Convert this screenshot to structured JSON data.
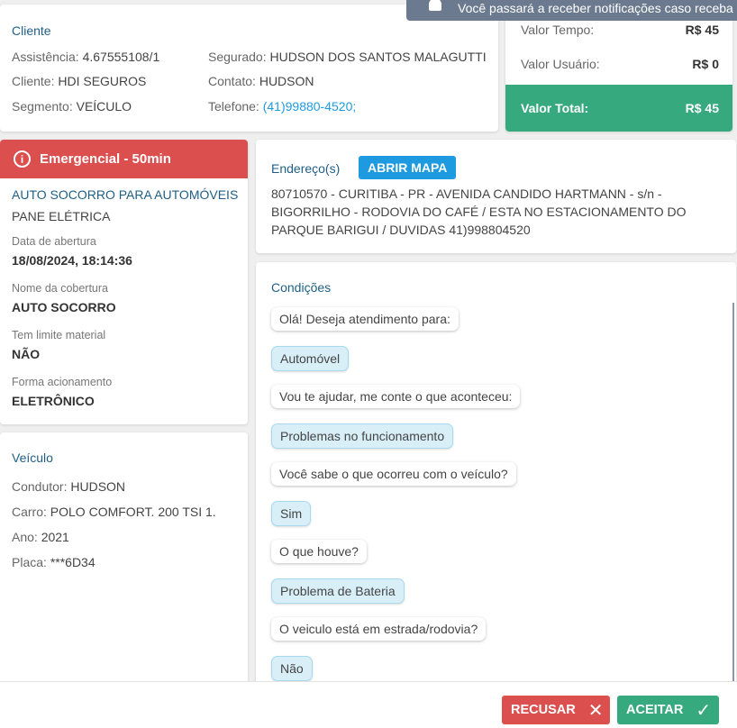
{
  "toast": {
    "text": "Você passará a receber notificações caso receba algum",
    "icon": "bell-icon"
  },
  "cliente": {
    "title": "Cliente",
    "assistencia_label": "Assistência:",
    "assistencia": "4.67555108/1",
    "cliente_label": "Cliente:",
    "cliente": "HDI SEGUROS",
    "segmento_label": "Segmento:",
    "segmento": "VEÍCULO",
    "segurado_label": "Segurado:",
    "segurado": "HUDSON DOS SANTOS MALAGUTTI",
    "contato_label": "Contato:",
    "contato": "HUDSON",
    "telefone_label": "Telefone:",
    "telefone": "(41)99880-4520;"
  },
  "valores": {
    "tempo_label": "Valor Tempo:",
    "tempo": "R$ 45",
    "usuario_label": "Valor Usuário:",
    "usuario": "R$ 0",
    "total_label": "Valor Total:",
    "total": "R$ 45",
    "total_color": "#36a97f"
  },
  "servico": {
    "badge": "Emergencial - 50min",
    "badge_color": "#dc4f4f",
    "title": "AUTO SOCORRO PARA AUTOMÓVEIS",
    "subtitle": "PANE ELÉTRICA",
    "fields": [
      {
        "label": "Data de abertura",
        "value": "18/08/2024, 18:14:36"
      },
      {
        "label": "Nome da cobertura",
        "value": "AUTO SOCORRO"
      },
      {
        "label": "Tem limite material",
        "value": "NÃO"
      },
      {
        "label": "Forma acionamento",
        "value": "ELETRÔNICO"
      }
    ]
  },
  "veiculo": {
    "title": "Veículo",
    "condutor_label": "Condutor:",
    "condutor": "HUDSON",
    "carro_label": "Carro:",
    "carro": "POLO COMFORT. 200 TSI 1.",
    "ano_label": "Ano:",
    "ano": "2021",
    "placa_label": "Placa:",
    "placa": "***6D34"
  },
  "endereco": {
    "title": "Endereço(s)",
    "map_button": "ABRIR MAPA",
    "lines": [
      "80710570 - CURITIBA - PR - AVENIDA CANDIDO HARTMANN - s/n -",
      "BIGORRILHO - RODOVIA DO CAFÉ / ESTA NO ESTACIONAMENTO DO",
      "PARQUE BARIGUI / DUVIDAS 41)998804520"
    ]
  },
  "condicoes": {
    "title": "Condições",
    "messages": [
      {
        "text": "Olá! Deseja atendimento para:",
        "type": "question"
      },
      {
        "text": "Automóvel",
        "type": "answer"
      },
      {
        "text": "Vou te ajudar, me conte o que aconteceu:",
        "type": "question"
      },
      {
        "text": "Problemas no funcionamento",
        "type": "answer"
      },
      {
        "text": "Você sabe o que ocorreu com o veículo?",
        "type": "question"
      },
      {
        "text": "Sim",
        "type": "answer"
      },
      {
        "text": "O que houve?",
        "type": "question"
      },
      {
        "text": "Problema de Bateria",
        "type": "answer"
      },
      {
        "text": "O veiculo está em estrada/rodovia?",
        "type": "question"
      },
      {
        "text": "Não",
        "type": "answer"
      }
    ]
  },
  "footer": {
    "recusar": "RECUSAR",
    "aceitar": "ACEITAR",
    "recusar_color": "#dc4f4f",
    "aceitar_color": "#36a97f"
  }
}
